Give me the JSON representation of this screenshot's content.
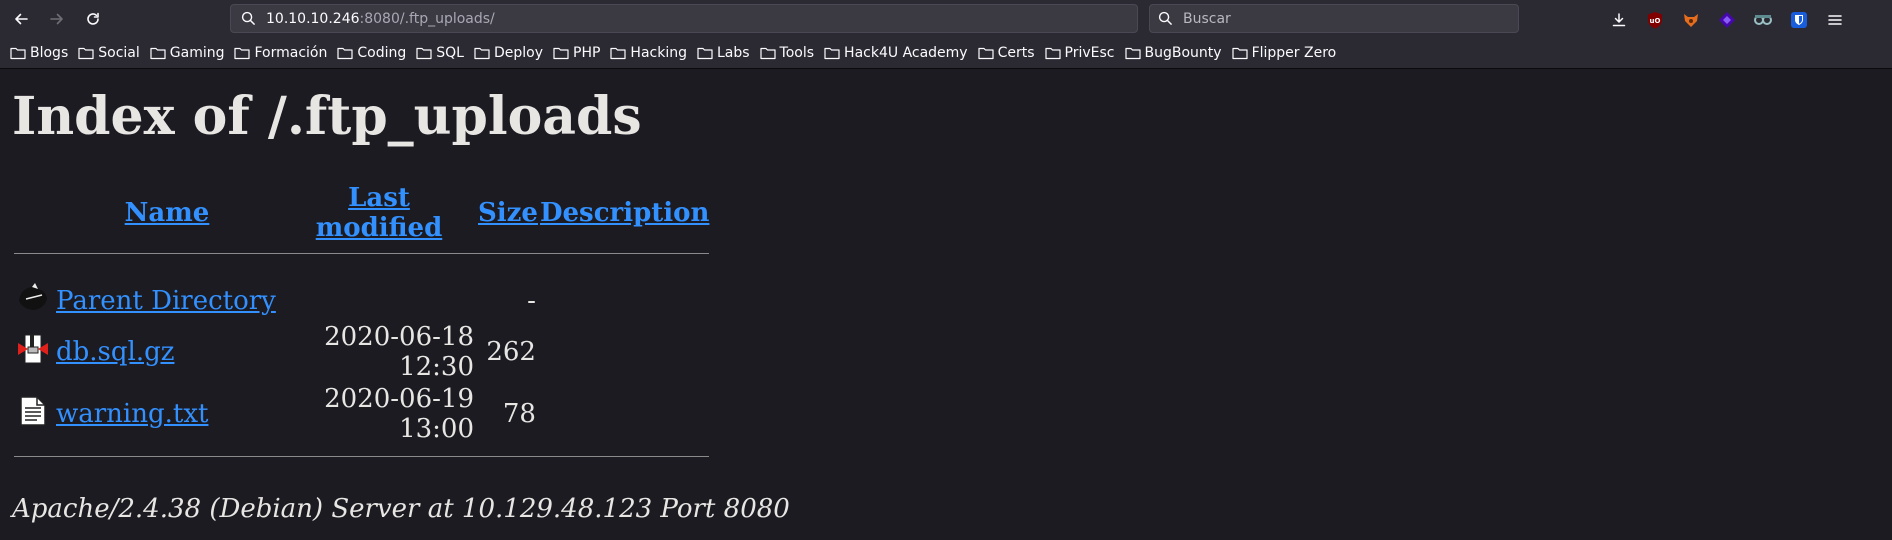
{
  "browser": {
    "url_host": "10.10.10.246",
    "url_rest": ":8080/.ftp_uploads/",
    "search_placeholder": "Buscar",
    "bookmarks": [
      "Blogs",
      "Social",
      "Gaming",
      "Formación",
      "Coding",
      "SQL",
      "Deploy",
      "PHP",
      "Hacking",
      "Labs",
      "Tools",
      "Hack4U Academy",
      "Certs",
      "PrivEsc",
      "BugBounty",
      "Flipper Zero"
    ],
    "toolbar_icons": [
      "download-icon",
      "ublock-icon",
      "foxyproxy-icon",
      "wappalyzer-icon",
      "cookie-editor-icon",
      "bitwarden-icon",
      "menu-icon"
    ]
  },
  "page": {
    "title": "Index of /.ftp_uploads",
    "columns": {
      "name": "Name",
      "modified": "Last modified",
      "size": "Size",
      "description": "Description"
    },
    "rows": [
      {
        "icon": "back-icon",
        "name": "Parent Directory",
        "modified": "",
        "size": "-",
        "description": ""
      },
      {
        "icon": "compressed-file-icon",
        "name": "db.sql.gz",
        "modified": "2020-06-18 12:30",
        "size": "262",
        "description": ""
      },
      {
        "icon": "text-file-icon",
        "name": "warning.txt",
        "modified": "2020-06-19 13:00",
        "size": "78",
        "description": ""
      }
    ],
    "address": "Apache/2.4.38 (Debian) Server at 10.129.48.123 Port 8080"
  },
  "colors": {
    "link": "#3391ff",
    "background": "#1c1b22",
    "chrome": "#2b2a33",
    "text": "#e8e6e3"
  }
}
